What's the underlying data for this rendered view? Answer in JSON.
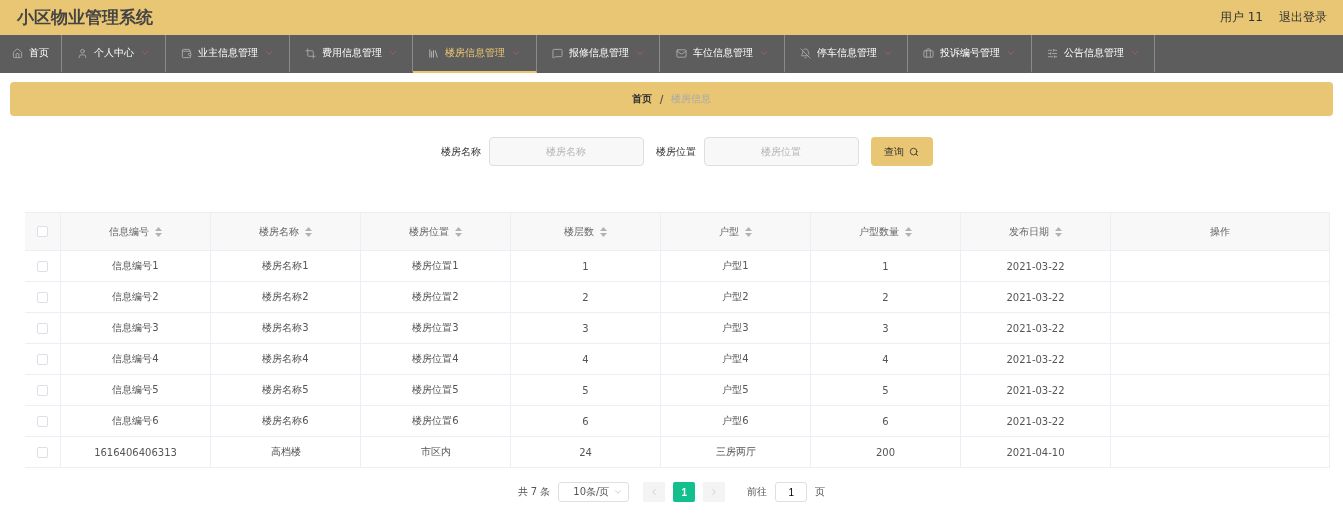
{
  "header": {
    "title": "小区物业管理系统",
    "user": "用户 11",
    "logout": "退出登录"
  },
  "nav": [
    {
      "label": "首页",
      "selected": false,
      "dropdown": false
    },
    {
      "label": "个人中心",
      "selected": false,
      "dropdown": true
    },
    {
      "label": "业主信息管理",
      "selected": false,
      "dropdown": true
    },
    {
      "label": "费用信息管理",
      "selected": false,
      "dropdown": true
    },
    {
      "label": "楼房信息管理",
      "selected": true,
      "dropdown": true
    },
    {
      "label": "报修信息管理",
      "selected": false,
      "dropdown": true
    },
    {
      "label": "车位信息管理",
      "selected": false,
      "dropdown": true
    },
    {
      "label": "停车信息管理",
      "selected": false,
      "dropdown": true
    },
    {
      "label": "投诉编号管理",
      "selected": false,
      "dropdown": true
    },
    {
      "label": "公告信息管理",
      "selected": false,
      "dropdown": true
    }
  ],
  "breadcrumb": {
    "home": "首页",
    "separator": "/",
    "current": "楼房信息"
  },
  "search": {
    "fields": [
      {
        "label": "楼房名称",
        "placeholder": "楼房名称"
      },
      {
        "label": "楼房位置",
        "placeholder": "楼房位置"
      }
    ],
    "button": "查询"
  },
  "table": {
    "header_checked": false,
    "columns": [
      {
        "label": "信息编号",
        "sortable": true
      },
      {
        "label": "楼房名称",
        "sortable": true
      },
      {
        "label": "楼房位置",
        "sortable": true
      },
      {
        "label": "楼层数",
        "sortable": true
      },
      {
        "label": "户型",
        "sortable": true
      },
      {
        "label": "户型数量",
        "sortable": true
      },
      {
        "label": "发布日期",
        "sortable": true
      },
      {
        "label": "操作",
        "sortable": false
      }
    ],
    "rows": [
      {
        "checked": false,
        "cells": [
          "信息编号1",
          "楼房名称1",
          "楼房位置1",
          "1",
          "户型1",
          "1",
          "2021-03-22"
        ]
      },
      {
        "checked": false,
        "cells": [
          "信息编号2",
          "楼房名称2",
          "楼房位置2",
          "2",
          "户型2",
          "2",
          "2021-03-22"
        ]
      },
      {
        "checked": false,
        "cells": [
          "信息编号3",
          "楼房名称3",
          "楼房位置3",
          "3",
          "户型3",
          "3",
          "2021-03-22"
        ]
      },
      {
        "checked": false,
        "cells": [
          "信息编号4",
          "楼房名称4",
          "楼房位置4",
          "4",
          "户型4",
          "4",
          "2021-03-22"
        ]
      },
      {
        "checked": false,
        "cells": [
          "信息编号5",
          "楼房名称5",
          "楼房位置5",
          "5",
          "户型5",
          "5",
          "2021-03-22"
        ]
      },
      {
        "checked": false,
        "cells": [
          "信息编号6",
          "楼房名称6",
          "楼房位置6",
          "6",
          "户型6",
          "6",
          "2021-03-22"
        ]
      },
      {
        "checked": false,
        "cells": [
          "1616406406313",
          "高档楼",
          "市区内",
          "24",
          "三房两厅",
          "200",
          "2021-04-10"
        ]
      }
    ]
  },
  "pagination": {
    "total": "共 7 条",
    "page_size": "10条/页",
    "prev_disabled": true,
    "next_disabled": true,
    "pages": [
      {
        "label": "1",
        "selected": true
      }
    ],
    "goto_label": "前往",
    "goto_value": "1",
    "goto_suffix": "页"
  }
}
